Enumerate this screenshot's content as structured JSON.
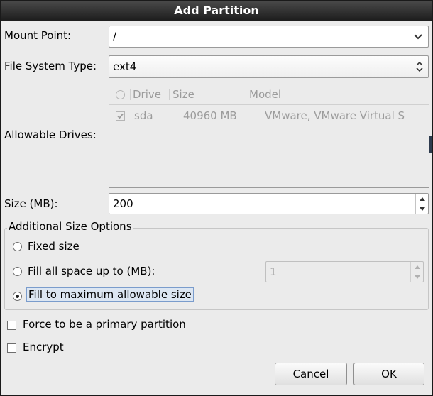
{
  "window": {
    "title": "Add Partition"
  },
  "mount_point": {
    "label": "Mount Point:",
    "value": "/"
  },
  "fs_type": {
    "label": "File System Type:",
    "value": "ext4"
  },
  "drives": {
    "label": "Allowable Drives:",
    "columns": [
      "Drive",
      "Size",
      "Model"
    ],
    "rows": [
      {
        "checked": true,
        "drive": "sda",
        "size": "40960 MB",
        "model": "VMware, VMware Virtual S"
      }
    ]
  },
  "size": {
    "label": "Size (MB):",
    "value": "200"
  },
  "additional": {
    "title": "Additional Size Options",
    "fixed": "Fixed size",
    "fill_upto": "Fill all space up to (MB):",
    "fill_upto_value": "1",
    "fill_max": "Fill to maximum allowable size",
    "selected": "fill_max"
  },
  "force_primary": {
    "label": "Force to be a primary partition",
    "checked": false
  },
  "encrypt": {
    "label": "Encrypt",
    "checked": false
  },
  "buttons": {
    "cancel": "Cancel",
    "ok": "OK"
  }
}
